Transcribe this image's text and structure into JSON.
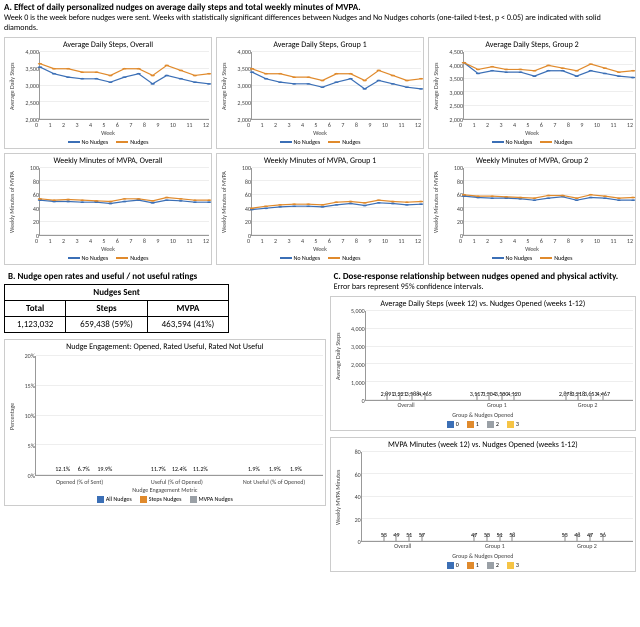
{
  "section_a": {
    "title": "A. Effect of daily personalized nudges on average daily steps and total weekly minutes of MVPA.",
    "subtitle": "Week 0 is the week before nudges were sent. Weeks with statistically significant differences between Nudges and No Nudges cohorts (one-tailed t-test, p < 0.05) are indicated with solid diamonds."
  },
  "section_b": {
    "title": "B. Nudge open rates and useful / not useful ratings"
  },
  "section_c": {
    "title": "C. Dose-response relationship between nudges opened and physical activity.",
    "subtitle": "Error bars represent 95% confidence intervals."
  },
  "weeks": [
    "0",
    "1",
    "2",
    "3",
    "4",
    "5",
    "6",
    "7",
    "8",
    "9",
    "10",
    "11",
    "12"
  ],
  "colors": {
    "blue": "#3b6fb6",
    "orange": "#e08a2c",
    "grey": "#9aa0a6",
    "yellow": "#f6c445"
  },
  "legend_labels": {
    "no_nudges": "No Nudges",
    "nudges": "Nudges"
  },
  "panels_a1": [
    {
      "title": "Average Daily Steps, Overall",
      "ylabel": "Average Daily Steps",
      "ymin": 2000,
      "ymax": 4000,
      "yticks": [
        2000,
        2500,
        3000,
        3500,
        4000
      ]
    },
    {
      "title": "Average Daily Steps, Group 1",
      "ylabel": "Average Daily Steps",
      "ymin": 2000,
      "ymax": 4000,
      "yticks": [
        2000,
        2500,
        3000,
        3500,
        4000
      ]
    },
    {
      "title": "Average Daily Steps, Group 2",
      "ylabel": "Average Daily Steps",
      "ymin": 2000,
      "ymax": 4500,
      "yticks": [
        2000,
        2500,
        3000,
        3500,
        4000,
        4500
      ]
    }
  ],
  "panels_a2": [
    {
      "title": "Weekly Minutes of MVPA, Overall",
      "ylabel": "Weekly Minutes of MVPA",
      "ymin": 0,
      "ymax": 100,
      "yticks": [
        0,
        20,
        40,
        60,
        80,
        100
      ]
    },
    {
      "title": "Weekly Minutes of MVPA, Group 1",
      "ylabel": "Weekly Minutes of MVPA",
      "ymin": 0,
      "ymax": 100,
      "yticks": [
        0,
        20,
        40,
        60,
        80,
        100
      ]
    },
    {
      "title": "Weekly Minutes of MVPA, Group 2",
      "ylabel": "Weekly Minutes of MVPA",
      "ymin": 0,
      "ymax": 100,
      "yticks": [
        0,
        20,
        40,
        60,
        80,
        100
      ]
    }
  ],
  "xlabel_week": "Week",
  "nudges_table": {
    "header": "Nudges Sent",
    "cols": [
      "Total",
      "Steps",
      "MVPA"
    ],
    "vals": [
      "1,123,032",
      "659,438  (59%)",
      "463,594  (41%)"
    ]
  },
  "bar_b": {
    "title": "Nudge Engagement: Opened, Rated Useful, Rated Not Useful",
    "ylabel": "Percentage",
    "xlabel": "Nudge Engagement Metric",
    "cats": [
      "Opened (% of Sent)",
      "Useful (% of Opened)",
      "Not Useful (% of Opened)"
    ],
    "legend": [
      "All Nudges",
      "Steps Nudges",
      "MVPA Nudges"
    ],
    "ymax": 20,
    "yticks": [
      0,
      5,
      10,
      15,
      20
    ]
  },
  "bar_c1": {
    "title": "Average Daily Steps (week 12) vs. Nudges Opened (weeks 1-12)",
    "ylabel": "Average Daily Steps",
    "xlabel": "Group & Nudges Opened",
    "groups": [
      "Overall",
      "Group 1",
      "Group 2"
    ],
    "legend": [
      "0",
      "1",
      "2",
      "3"
    ],
    "ymax": 5000,
    "yticks": [
      0,
      1000,
      2000,
      3000,
      4000,
      5000
    ]
  },
  "bar_c2": {
    "title": "MVPA Minutes (week 12) vs. Nudges Opened (weeks 1-12)",
    "ylabel": "Weekly MVPA Minutes",
    "xlabel": "Group & Nudges Opened",
    "groups": [
      "Overall",
      "Group 1",
      "Group 2"
    ],
    "legend": [
      "0",
      "1",
      "2",
      "3"
    ],
    "ymax": 80,
    "yticks": [
      0,
      20,
      40,
      60,
      80
    ]
  },
  "chart_data": [
    {
      "type": "line",
      "title": "Average Daily Steps, Overall",
      "xlabel": "Week",
      "ylabel": "Average Daily Steps",
      "ylim": [
        2000,
        4000
      ],
      "x": [
        0,
        1,
        2,
        3,
        4,
        5,
        6,
        7,
        8,
        9,
        10,
        11,
        12
      ],
      "series": [
        {
          "name": "No Nudges",
          "color": "#3b6fb6",
          "values": [
            3550,
            3350,
            3250,
            3200,
            3200,
            3100,
            3250,
            3350,
            3050,
            3300,
            3200,
            3100,
            3050
          ]
        },
        {
          "name": "Nudges",
          "color": "#e08a2c",
          "values": [
            3650,
            3500,
            3500,
            3400,
            3400,
            3300,
            3500,
            3500,
            3300,
            3600,
            3450,
            3300,
            3350
          ]
        }
      ]
    },
    {
      "type": "line",
      "title": "Average Daily Steps, Group 1",
      "xlabel": "Week",
      "ylabel": "Average Daily Steps",
      "ylim": [
        2000,
        4000
      ],
      "x": [
        0,
        1,
        2,
        3,
        4,
        5,
        6,
        7,
        8,
        9,
        10,
        11,
        12
      ],
      "series": [
        {
          "name": "No Nudges",
          "color": "#3b6fb6",
          "values": [
            3400,
            3200,
            3100,
            3050,
            3050,
            2950,
            3100,
            3200,
            2900,
            3150,
            3050,
            2950,
            2900
          ]
        },
        {
          "name": "Nudges",
          "color": "#e08a2c",
          "values": [
            3500,
            3350,
            3350,
            3250,
            3250,
            3150,
            3350,
            3350,
            3150,
            3450,
            3300,
            3150,
            3200
          ]
        }
      ]
    },
    {
      "type": "line",
      "title": "Average Daily Steps, Group 2",
      "xlabel": "Week",
      "ylabel": "Average Daily Steps",
      "ylim": [
        2000,
        4500
      ],
      "x": [
        0,
        1,
        2,
        3,
        4,
        5,
        6,
        7,
        8,
        9,
        10,
        11,
        12
      ],
      "series": [
        {
          "name": "No Nudges",
          "color": "#3b6fb6",
          "values": [
            4100,
            3700,
            3800,
            3750,
            3750,
            3600,
            3800,
            3800,
            3600,
            3800,
            3700,
            3600,
            3550
          ]
        },
        {
          "name": "Nudges",
          "color": "#e08a2c",
          "values": [
            4100,
            3850,
            3950,
            3850,
            3850,
            3800,
            4000,
            3900,
            3800,
            4050,
            3900,
            3750,
            3800
          ]
        }
      ]
    },
    {
      "type": "line",
      "title": "Weekly Minutes of MVPA, Overall",
      "xlabel": "Week",
      "ylabel": "Weekly Minutes of MVPA",
      "ylim": [
        0,
        100
      ],
      "x": [
        0,
        1,
        2,
        3,
        4,
        5,
        6,
        7,
        8,
        9,
        10,
        11,
        12
      ],
      "series": [
        {
          "name": "No Nudges",
          "color": "#3b6fb6",
          "values": [
            52,
            50,
            50,
            49,
            49,
            47,
            50,
            52,
            48,
            52,
            51,
            49,
            49
          ]
        },
        {
          "name": "Nudges",
          "color": "#e08a2c",
          "values": [
            54,
            52,
            53,
            52,
            51,
            50,
            54,
            54,
            51,
            56,
            54,
            52,
            52
          ]
        }
      ]
    },
    {
      "type": "line",
      "title": "Weekly Minutes of MVPA, Group 1",
      "xlabel": "Week",
      "ylabel": "Weekly Minutes of MVPA",
      "ylim": [
        0,
        100
      ],
      "x": [
        0,
        1,
        2,
        3,
        4,
        5,
        6,
        7,
        8,
        9,
        10,
        11,
        12
      ],
      "series": [
        {
          "name": "No Nudges",
          "color": "#3b6fb6",
          "values": [
            38,
            40,
            42,
            43,
            43,
            42,
            45,
            47,
            44,
            48,
            47,
            45,
            46
          ]
        },
        {
          "name": "Nudges",
          "color": "#e08a2c",
          "values": [
            40,
            43,
            45,
            46,
            46,
            45,
            49,
            50,
            48,
            52,
            50,
            49,
            50
          ]
        }
      ]
    },
    {
      "type": "line",
      "title": "Weekly Minutes of MVPA, Group 2",
      "xlabel": "Week",
      "ylabel": "Weekly Minutes of MVPA",
      "ylim": [
        0,
        100
      ],
      "x": [
        0,
        1,
        2,
        3,
        4,
        5,
        6,
        7,
        8,
        9,
        10,
        11,
        12
      ],
      "series": [
        {
          "name": "No Nudges",
          "color": "#3b6fb6",
          "values": [
            58,
            56,
            55,
            55,
            54,
            52,
            55,
            57,
            52,
            56,
            55,
            52,
            52
          ]
        },
        {
          "name": "Nudges",
          "color": "#e08a2c",
          "values": [
            60,
            58,
            58,
            57,
            56,
            55,
            59,
            59,
            55,
            60,
            58,
            55,
            56
          ]
        }
      ]
    },
    {
      "type": "bar",
      "title": "Nudge Engagement: Opened, Rated Useful, Rated Not Useful",
      "xlabel": "Nudge Engagement Metric",
      "ylabel": "Percentage",
      "ylim": [
        0,
        20
      ],
      "categories": [
        "Opened (% of Sent)",
        "Useful (% of Opened)",
        "Not Useful (% of Opened)"
      ],
      "series": [
        {
          "name": "All Nudges",
          "color": "#3b6fb6",
          "values": [
            12.1,
            11.7,
            1.9
          ]
        },
        {
          "name": "Steps Nudges",
          "color": "#e08a2c",
          "values": [
            6.7,
            12.4,
            1.9
          ]
        },
        {
          "name": "MVPA Nudges",
          "color": "#9aa0a6",
          "values": [
            19.9,
            11.2,
            1.9
          ]
        }
      ]
    },
    {
      "type": "bar",
      "title": "Average Daily Steps (week 12) vs. Nudges Opened (weeks 1-12)",
      "xlabel": "Group & Nudges Opened",
      "ylabel": "Average Daily Steps",
      "ylim": [
        0,
        5000
      ],
      "categories": [
        "Overall",
        "Group 1",
        "Group 2"
      ],
      "series": [
        {
          "name": "0",
          "color": "#3b6fb6",
          "values": [
            2891,
            3117,
            2878
          ]
        },
        {
          "name": "1",
          "color": "#e08a2c",
          "values": [
            3221,
            3304,
            3218
          ]
        },
        {
          "name": "2",
          "color": "#9aa0a6",
          "values": [
            3588,
            3500,
            3653
          ]
        },
        {
          "name": "3",
          "color": "#f6c445",
          "values": [
            4465,
            4120,
            4467
          ]
        }
      ]
    },
    {
      "type": "bar",
      "title": "MVPA Minutes (week 12) vs. Nudges Opened (weeks 1-12)",
      "xlabel": "Group & Nudges Opened",
      "ylabel": "Weekly MVPA Minutes",
      "ylim": [
        0,
        80
      ],
      "categories": [
        "Overall",
        "Group 1",
        "Group 2"
      ],
      "series": [
        {
          "name": "0",
          "color": "#3b6fb6",
          "values": [
            53,
            47,
            53
          ]
        },
        {
          "name": "1",
          "color": "#e08a2c",
          "values": [
            49,
            50,
            48
          ]
        },
        {
          "name": "2",
          "color": "#9aa0a6",
          "values": [
            51,
            51,
            47
          ]
        },
        {
          "name": "3",
          "color": "#f6c445",
          "values": [
            57,
            58,
            56
          ]
        }
      ]
    }
  ]
}
